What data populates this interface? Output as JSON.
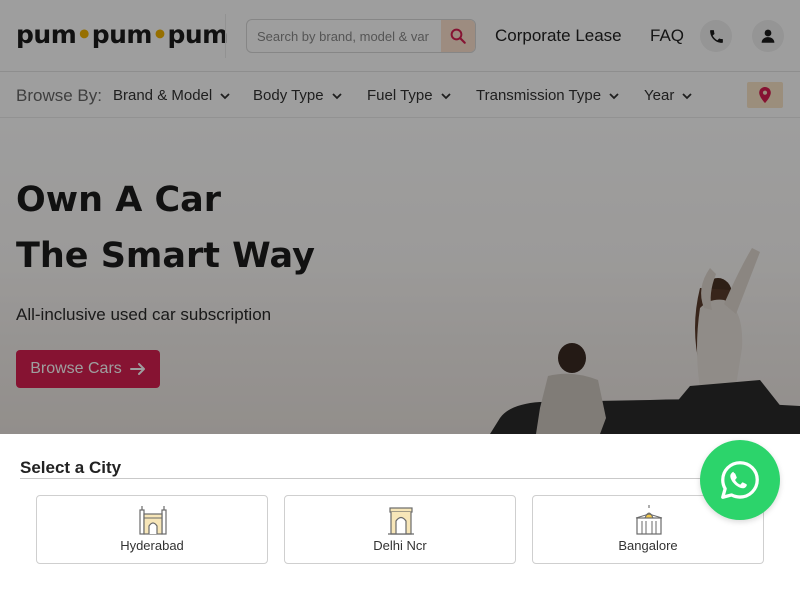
{
  "header": {
    "logo_parts": [
      "pum",
      "pum",
      "pum"
    ],
    "logo_dot": "•",
    "search": {
      "placeholder": "Search by brand, model & var"
    },
    "nav": {
      "corporate_lease": "Corporate Lease",
      "faq": "FAQ"
    }
  },
  "browse": {
    "label": "Browse By:",
    "filters": [
      "Brand & Model",
      "Body Type",
      "Fuel Type",
      "Transmission Type",
      "Year"
    ]
  },
  "hero": {
    "title_line1": "Own A Car",
    "title_line2": "The Smart Way",
    "subtitle": "All-inclusive used car subscription",
    "cta": "Browse Cars"
  },
  "city_select": {
    "title": "Select a City",
    "cities": [
      "Hyderabad",
      "Delhi Ncr",
      "Bangalore"
    ]
  },
  "colors": {
    "accent": "#d81f52",
    "logo_dot": "#f2b400",
    "whatsapp": "#2cd46b",
    "search_button_bg": "#fde3cf"
  },
  "icons": {
    "search": "search-icon",
    "phone": "phone-icon",
    "user": "user-icon",
    "location": "map-pin-icon",
    "whatsapp": "whatsapp-icon",
    "arrow": "arrow-right-icon",
    "chevron": "chevron-down-icon"
  }
}
